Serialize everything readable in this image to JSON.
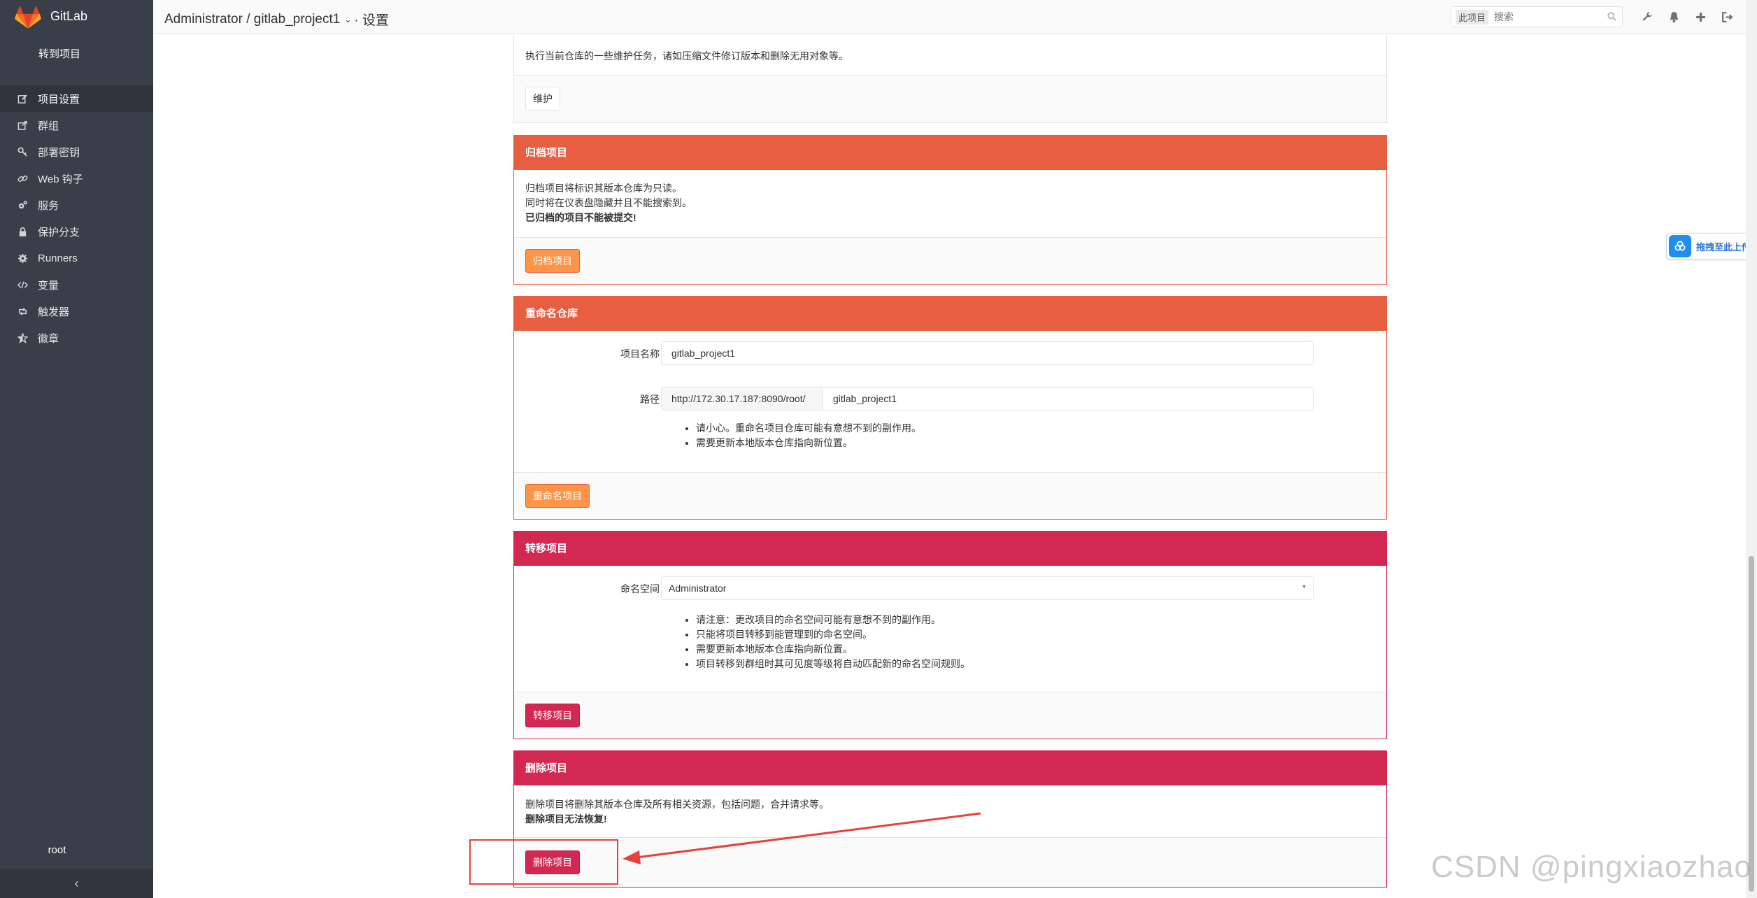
{
  "app": {
    "name": "GitLab"
  },
  "sidebar": {
    "goto_project": "转到项目",
    "items": [
      {
        "label": "项目设置",
        "icon": "edit-icon",
        "active": true
      },
      {
        "label": "群组",
        "icon": "share-icon"
      },
      {
        "label": "部署密钥",
        "icon": "key-icon"
      },
      {
        "label": "Web 钩子",
        "icon": "link-icon"
      },
      {
        "label": "服务",
        "icon": "cogs-icon"
      },
      {
        "label": "保护分支",
        "icon": "lock-icon"
      },
      {
        "label": "Runners",
        "icon": "gear-icon"
      },
      {
        "label": "变量",
        "icon": "code-icon"
      },
      {
        "label": "触发器",
        "icon": "retweet-icon"
      },
      {
        "label": "徽章",
        "icon": "star-half-icon"
      }
    ],
    "user": "root",
    "collapse": "‹"
  },
  "header": {
    "breadcrumb_path": "Administrator / gitlab_project1",
    "breadcrumb_caret": "⌄",
    "breadcrumb_page": "· 设置",
    "search_scope": "此项目",
    "search_placeholder": "搜索",
    "icons": [
      "wrench-icon",
      "bell-icon",
      "plus-icon",
      "sign-out-icon"
    ]
  },
  "housekeeping": {
    "description": "执行当前仓库的一些维护任务，诸如压缩文件修订版本和删除无用对象等。",
    "button": "维护"
  },
  "archive": {
    "title": "归档项目",
    "lines": [
      "归档项目将标识其版本仓库为只读。",
      "同时将在仪表盘隐藏并且不能搜索到。"
    ],
    "bold_line": "已归档的项目不能被提交!",
    "button": "归档项目"
  },
  "rename": {
    "title": "重命名仓库",
    "name_label": "项目名称",
    "name_value": "gitlab_project1",
    "path_label": "路径",
    "path_prefix": "http://172.30.17.187:8090/root/",
    "path_value": "gitlab_project1",
    "notes": [
      "请小心。重命名项目仓库可能有意想不到的副作用。",
      "需要更新本地版本仓库指向新位置。"
    ],
    "button": "重命名项目"
  },
  "transfer": {
    "title": "转移项目",
    "namespace_label": "命名空间",
    "namespace_value": "Administrator",
    "notes": [
      "请注意：更改项目的命名空间可能有意想不到的副作用。",
      "只能将项目转移到能管理到的命名空间。",
      "需要更新本地版本仓库指向新位置。",
      "项目转移到群组时其可见度等级将自动匹配新的命名空间规则。"
    ],
    "button": "转移项目"
  },
  "remove": {
    "title": "删除项目",
    "line": "删除项目将删除其版本仓库及所有相关资源，包括问题，合并请求等。",
    "bold_line": "删除项目无法恢复!",
    "button": "删除项目"
  },
  "upload_widget": {
    "label": "拖拽至此上传"
  },
  "watermark": "CSDN @pingxiaozhao",
  "colors": {
    "warning": "#e75e40",
    "danger": "#d22852",
    "sidebar": "#393f49",
    "accent_orange": "#fc9547"
  }
}
